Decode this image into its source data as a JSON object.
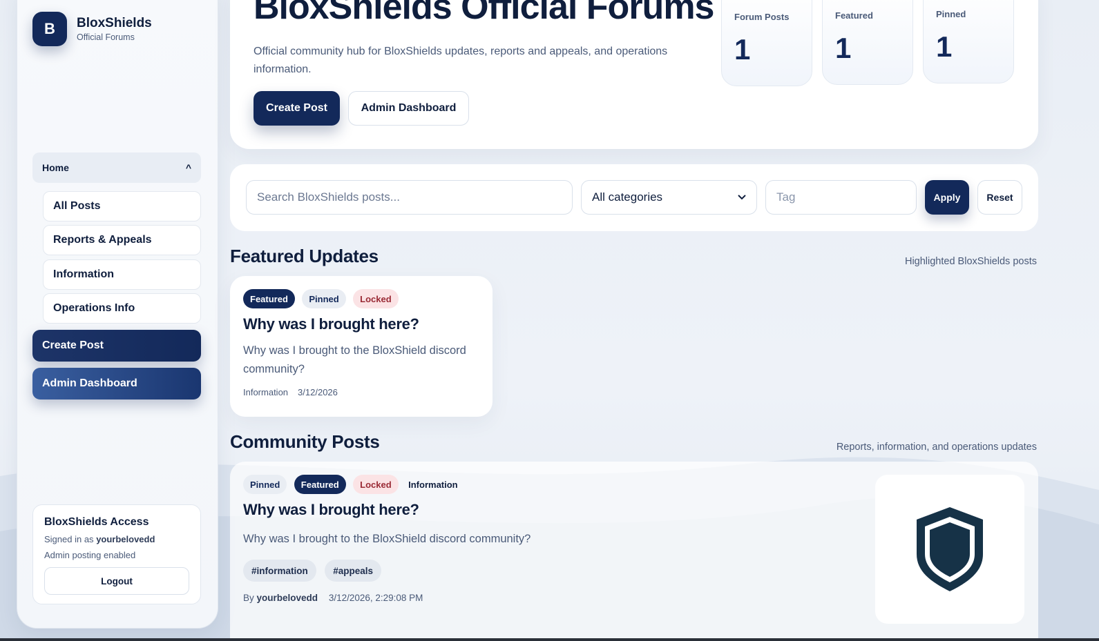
{
  "brand": {
    "logo_letter": "B",
    "name": "BloxShields",
    "subtitle": "Official Forums"
  },
  "sidebar": {
    "home_label": "Home",
    "home_caret": "^",
    "items": [
      {
        "label": "All Posts"
      },
      {
        "label": "Reports & Appeals"
      },
      {
        "label": "Information"
      },
      {
        "label": "Operations Info"
      }
    ],
    "create_post_label": "Create Post",
    "admin_dashboard_label": "Admin Dashboard",
    "access": {
      "title": "BloxShields Access",
      "signed_in_prefix": "Signed in as",
      "username": "yourbelovedd",
      "status": "Admin posting enabled",
      "logout_label": "Logout"
    }
  },
  "hero": {
    "title": "BloxShields Official Forums",
    "description": "Official community hub for BloxShields updates, reports and appeals, and operations information.",
    "create_post_label": "Create Post",
    "admin_dashboard_label": "Admin Dashboard",
    "stats": [
      {
        "label": "Forum Posts",
        "value": "1"
      },
      {
        "label": "Featured",
        "value": "1"
      },
      {
        "label": "Pinned",
        "value": "1"
      }
    ]
  },
  "filter": {
    "search_placeholder": "Search BloxShields posts...",
    "category_selected": "All categories",
    "tag_placeholder": "Tag",
    "apply_label": "Apply",
    "reset_label": "Reset"
  },
  "featured": {
    "title": "Featured Updates",
    "subtitle": "Highlighted BloxShields posts",
    "card": {
      "badges": [
        "Featured",
        "Pinned",
        "Locked"
      ],
      "title": "Why was I brought here?",
      "excerpt": "Why was I brought to the BloxShield discord community?",
      "category": "Information",
      "date": "3/12/2026"
    }
  },
  "community": {
    "title": "Community Posts",
    "subtitle": "Reports, information, and operations updates",
    "post": {
      "badges": [
        "Pinned",
        "Featured",
        "Locked"
      ],
      "category": "Information",
      "title": "Why was I brought here?",
      "excerpt": "Why was I brought to the BloxShield discord community?",
      "tags": [
        "#information",
        "#appeals"
      ],
      "by_prefix": "By",
      "author": "yourbelovedd",
      "timestamp": "3/12/2026, 2:29:08 PM",
      "thumbnail_icon": "shield-icon"
    }
  },
  "colors": {
    "primary": "#13295a",
    "accent_blue": "#3a5fa0",
    "locked_text": "#9a2a35",
    "shield_fill": "#163247"
  }
}
